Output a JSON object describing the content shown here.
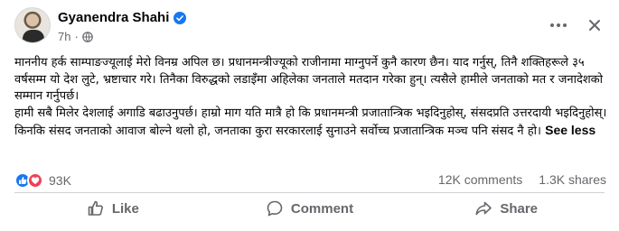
{
  "post": {
    "author": "Gyanendra Shahi",
    "timestamp": "7h",
    "paragraphs": [
      "माननीय हर्क साम्पाङज्यूलाई मेरो विनम्र अपिल छ। प्रधानमन्त्रीज्यूको राजीनामा माग्नुपर्ने कुनै कारण छैन। याद गर्नुस्, तिनै शक्तिहरूले ३५ वर्षसम्म यो देश लुटे, भ्रष्टाचार गरे। तिनैका विरुद्धको लडाइँमा अहिलेका जनताले मतदान गरेका हुन्। त्यसैले हामीले जनताको मत र जनादेशको सम्मान गर्नुपर्छ।",
      "हामी सबै मिलेर देशलाई अगाडि बढाउनुपर्छ। हाम्रो माग यति मात्रै हो कि प्रधानमन्त्री प्रजातान्त्रिक भइदिनुहोस्, संसदप्रति उत्तरदायी भइदिनुहोस्। किनकि संसद जनताको आवाज बोल्ने थलो हो, जनताका कुरा सरकारलाई सुनाउने सर्वोच्च प्रजातान्त्रिक मञ्च पनि संसद नै हो।"
    ],
    "see_less_label": "See less"
  },
  "engagement": {
    "reactions_count": "93K",
    "comments": "12K comments",
    "shares": "1.3K shares"
  },
  "actions": {
    "like": "Like",
    "comment": "Comment",
    "share": "Share"
  },
  "icons": {
    "verified": "verified-badge-icon",
    "privacy": "globe-icon",
    "more": "more-options-icon",
    "close": "close-icon",
    "like_reaction": "thumbs-up-icon",
    "love_reaction": "heart-icon"
  },
  "colors": {
    "brand_blue": "#1877f2",
    "love_red": "#f33e58",
    "secondary_text": "#65676b",
    "divider": "#ced0d4"
  }
}
